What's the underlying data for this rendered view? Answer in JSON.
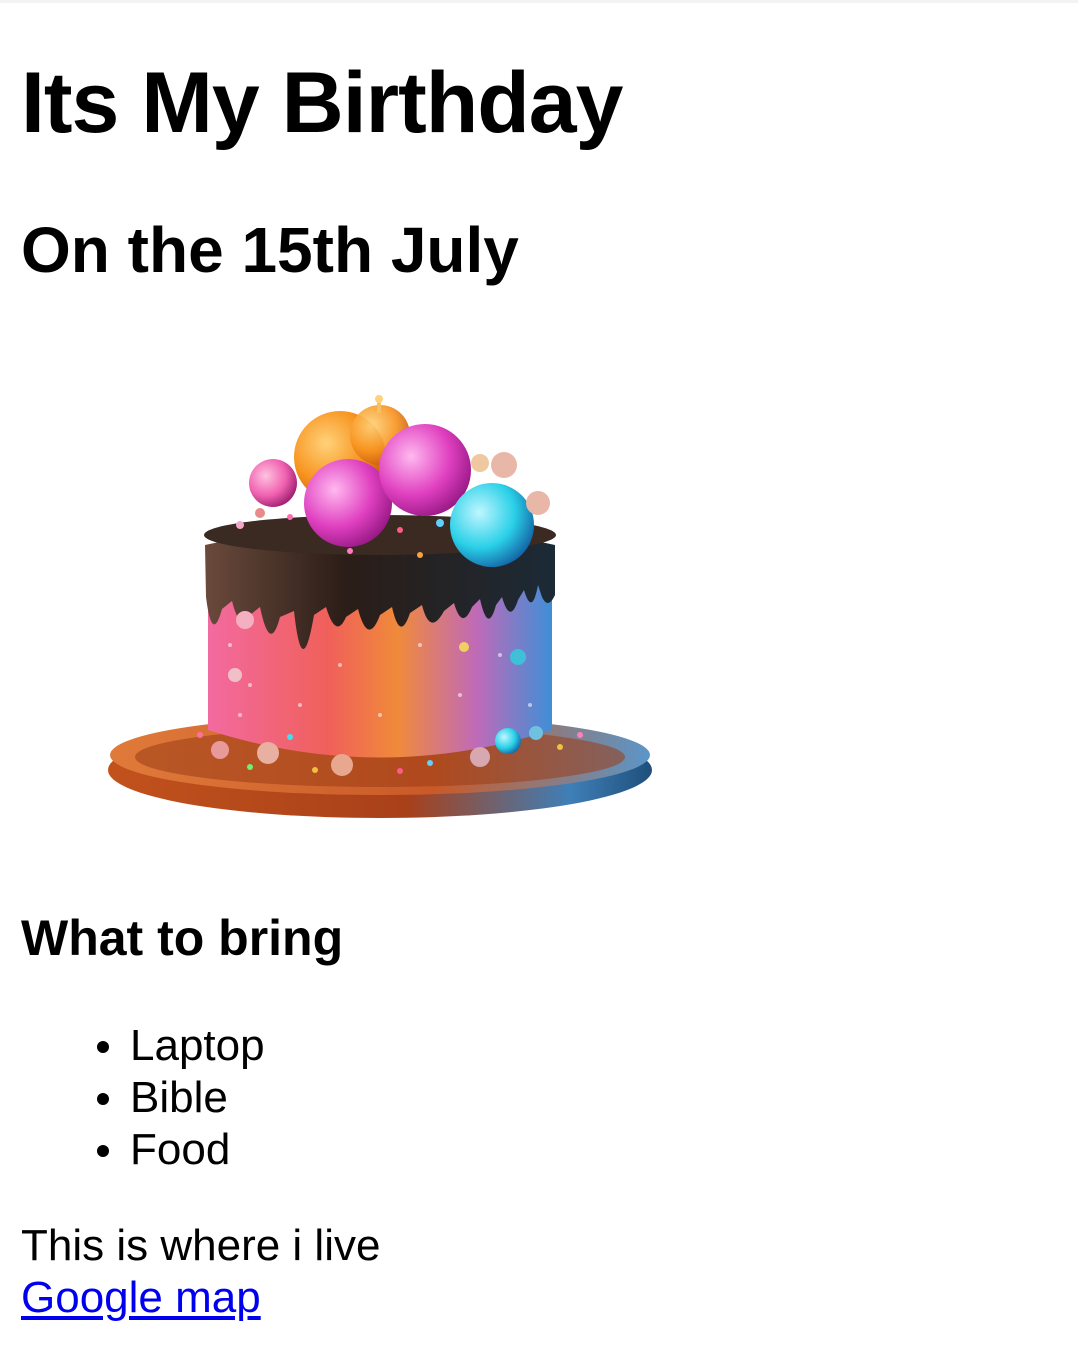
{
  "header": {
    "title": "Its My Birthday",
    "subtitle": "On the 15th July"
  },
  "image": {
    "icon": "birthday-cake-image",
    "colors": {
      "plate": "#c2521c",
      "chocolate": "#2b1d17",
      "cake_pink": "#f0609a",
      "cake_orange": "#f08a3a",
      "cake_blue": "#3e8fd6",
      "ball_orange": "#f7931e",
      "ball_pink": "#e040c0",
      "ball_cyan": "#2ad0e8"
    }
  },
  "bring": {
    "heading": "What to bring",
    "items": [
      {
        "label": "Laptop"
      },
      {
        "label": "Bible"
      },
      {
        "label": "Food"
      }
    ]
  },
  "location": {
    "text": "This is where i live",
    "link_label": "Google map",
    "link_color": "#0000ee"
  }
}
